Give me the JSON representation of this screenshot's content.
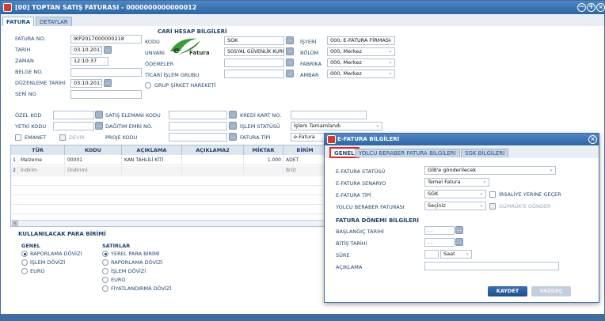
{
  "window": {
    "title": "[00] TOPTAN SATIŞ FATURASI - 0000000000000012"
  },
  "tabs": [
    {
      "label": "FATURA"
    },
    {
      "label": "DETAYLAR"
    }
  ],
  "invoice": {
    "no_label": "FATURA NO.",
    "no_value": "IKP2017000000218",
    "date_label": "TARİH",
    "date_value": "03.10.2017",
    "time_label": "ZAMAN",
    "time_value": "12:10:37",
    "doc_label": "BELGE NO.",
    "edit_date_label": "DÜZENLEME TARİHİ",
    "edit_date_value": "03.10.2017",
    "serial_label": "SERİ NO"
  },
  "account": {
    "title": "CARİ HESAP BİLGİLERİ",
    "code_label": "KODU",
    "code_value": "SGK",
    "title_label": "UNVANI",
    "title_value": "SOSYAL GÜVENLİK KURUMU",
    "payments_label": "ÖDEMELER",
    "group_label": "TİCARİ İŞLEM GRUBU",
    "group_company_label": "GRUP ŞİRKET HAREKETİ",
    "logo_letter": "e",
    "logo_text": "Fatura"
  },
  "org": {
    "workplace_label": "İŞYERİ",
    "workplace_value": "000, E-FATURA FİRMASI",
    "division_label": "BÖLÜM",
    "division_value": "000, Merkez",
    "factory_label": "FABRİKA",
    "factory_value": "000, Merkez",
    "warehouse_label": "AMBAR",
    "warehouse_value": "000, Merkez"
  },
  "extra": {
    "special_code_label": "ÖZEL KOD",
    "auth_code_label": "YETKİ KODU",
    "deposit_label": "EMANET",
    "transfer_label": "DEVİR",
    "salesman_label": "SATIŞ ELEMANI KODU",
    "dispatch_label": "DAĞITIM EMRİ NO.",
    "project_label": "PROJE KODU",
    "credit_card_label": "KREDİ KART NO.",
    "status_label": "İŞLEM STATÜSÜ",
    "status_value": "İşlem Tamamlandı",
    "invoice_type_label": "FATURA TİPİ",
    "invoice_type_value": "e-Fatura"
  },
  "table": {
    "headers": [
      "TÜR",
      "KODU",
      "AÇIKLAMA",
      "AÇIKLAMA2",
      "MİKTAR",
      "BİRİM"
    ],
    "rows": [
      {
        "num": "1",
        "type": "Malzeme",
        "code": "00001",
        "desc": "KAN TAHLİLİ KİTİ",
        "desc2": "",
        "qty": "1.000",
        "unit": "ADET"
      },
      {
        "num": "2",
        "type": "İndirim",
        "code": "(İndirim)",
        "desc": "",
        "desc2": "",
        "qty": "",
        "unit": "Brüt"
      }
    ]
  },
  "currency": {
    "title": "KULLANILACAK PARA BİRİMİ",
    "general_label": "GENEL",
    "general_options": [
      "RAPORLAMA DÖVİZİ",
      "İŞLEM DÖVİZİ",
      "EURO"
    ],
    "lines_label": "SATIRLAR",
    "lines_options": [
      "YEREL PARA BİRİMİ",
      "RAPORLAMA DÖVİZİ",
      "İŞLEM DÖVİZİ",
      "EURO",
      "FİYATLANDIRMA DÖVİZİ"
    ]
  },
  "dialog": {
    "title": "E-FATURA BİLGİLERİ",
    "tabs": [
      "GENEL",
      "YOLCU BERABER FATURA BİLGİLERİ",
      "SGK BİLGİLERİ"
    ],
    "status_label": "E-FATURA STATÜSÜ",
    "status_value": "GİB'e gönderilecek",
    "scenario_label": "E-FATURA SENARYO",
    "scenario_value": "Temel Fatura",
    "type_label": "E-FATURA TİPİ",
    "type_value": "SGK",
    "waybill_label": "İRSALİYE YERİNE GEÇER",
    "passenger_label": "YOLCU BERABER FATURASI",
    "passenger_value": "Seçiniz",
    "customs_label": "GÜMRÜK'E GÖNDER",
    "period_title": "FATURA DÖNEMİ BİLGİLERİ",
    "start_label": "BAŞLANGIÇ TARİHİ",
    "start_value": ". .",
    "end_label": "BİTİŞ TARİHİ",
    "end_value": ". .",
    "duration_label": "SÜRE",
    "duration_unit": "Saat",
    "desc_label": "AÇIKLAMA",
    "save_label": "KAYDET",
    "cancel_label": "VAZGEÇ"
  }
}
